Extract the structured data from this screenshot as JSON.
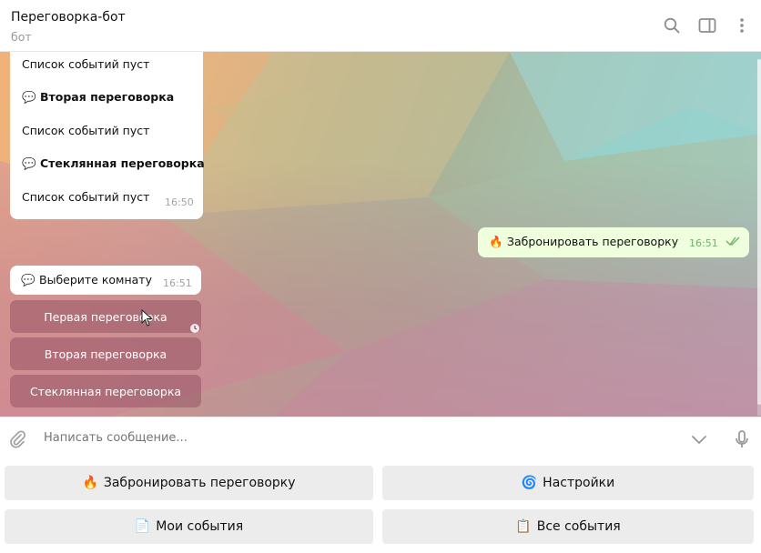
{
  "header": {
    "title": "Переговорка-бот",
    "subtitle": "бот",
    "icons": [
      "search-icon",
      "sidebar-toggle-icon",
      "more-vertical-icon"
    ]
  },
  "messages": {
    "events_list": {
      "lines": [
        {
          "emoji": "",
          "text": "Список событий пуст"
        },
        {
          "emoji": "💬",
          "text": "Вторая переговорка"
        },
        {
          "emoji": "",
          "text": "Список событий пуст"
        },
        {
          "emoji": "💬",
          "text": "Стеклянная переговорка"
        },
        {
          "emoji": "",
          "text": "Список событий пуст"
        }
      ],
      "time": "16:50"
    },
    "outgoing": {
      "emoji": "🔥",
      "text": "Забронировать переговорку",
      "time": "16:51"
    },
    "choose_room": {
      "emoji": "💬",
      "text": "Выберите комнату",
      "time": "16:51"
    }
  },
  "inline_buttons": [
    {
      "label": "Первая переговорка"
    },
    {
      "label": "Вторая переговорка"
    },
    {
      "label": "Стеклянная переговорка"
    }
  ],
  "composer": {
    "placeholder": "Написать сообщение..."
  },
  "keyboard": [
    {
      "emoji": "🔥",
      "label": "Забронировать переговорку"
    },
    {
      "emoji": "🌀",
      "label": "Настройки"
    },
    {
      "emoji": "📄",
      "label": "Мои события"
    },
    {
      "emoji": "📋",
      "label": "Все события"
    }
  ],
  "colors": {
    "outgoing_bubble": "#effedd",
    "inline_button": "#8c465a",
    "keyboard_button": "#ececec"
  }
}
